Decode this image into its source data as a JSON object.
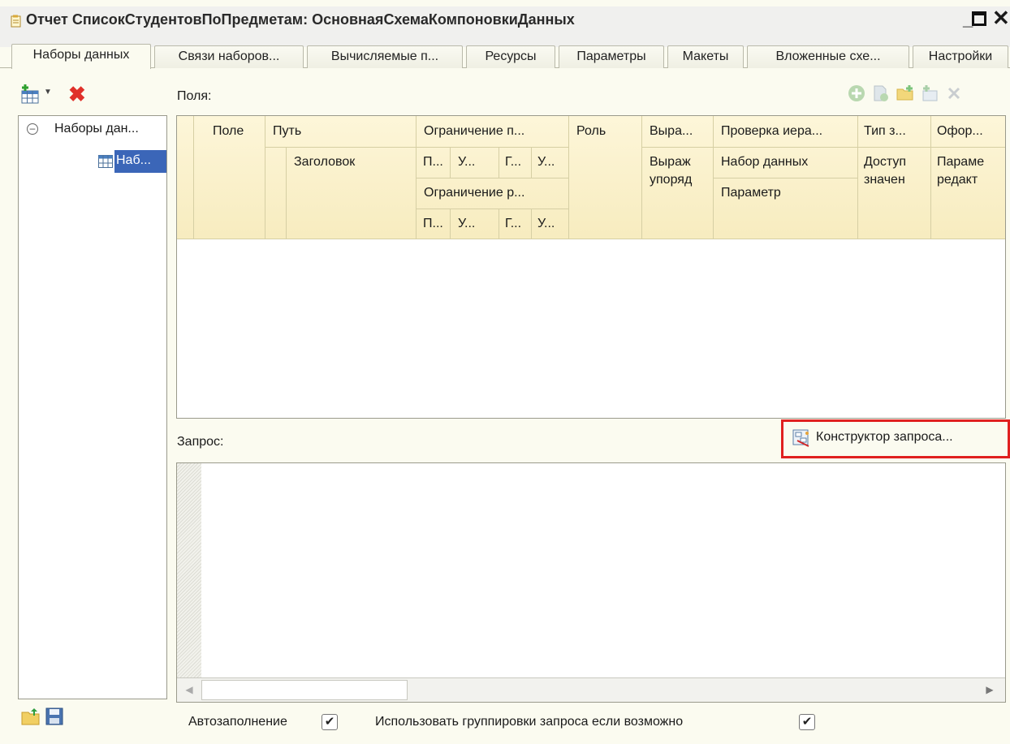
{
  "window": {
    "title": "Отчет СписокСтудентовПоПредметам: ОсновнаяСхемаКомпоновкиДанных",
    "icon": "report-icon"
  },
  "tabs": [
    {
      "label": "Наборы данных",
      "active": true
    },
    {
      "label": "Связи наборов...",
      "active": false
    },
    {
      "label": "Вычисляемые п...",
      "active": false
    },
    {
      "label": "Ресурсы",
      "active": false
    },
    {
      "label": "Параметры",
      "active": false
    },
    {
      "label": "Макеты",
      "active": false
    },
    {
      "label": "Вложенные схе...",
      "active": false
    },
    {
      "label": "Настройки",
      "active": false
    }
  ],
  "tree": {
    "root": "Наборы дан...",
    "child": "Наб..."
  },
  "fields": {
    "label": "Поля:",
    "headers": {
      "field": "Поле",
      "path": "Путь",
      "title": "Заголовок",
      "restriction_top": "Ограничение п...",
      "restriction_top_sub": [
        "П...",
        "У...",
        "Г...",
        "У..."
      ],
      "restriction_bottom": "Ограничение р...",
      "restriction_bottom_sub": [
        "П...",
        "У...",
        "Г...",
        "У..."
      ],
      "role": "Роль",
      "expr": "Выра...",
      "expr_order_1": "Выраж",
      "expr_order_2": "упоряд",
      "hierarchy": "Проверка иера...",
      "dataset": "Набор данных",
      "parameter": "Параметр",
      "type": "Тип з...",
      "avail_1": "Доступ",
      "avail_2": "значен",
      "format": "Офор...",
      "params_1": "Параме",
      "params_2": "редакт"
    },
    "rows": []
  },
  "query": {
    "label": "Запрос:",
    "constructor_label": "Конструктор запроса...",
    "text": ""
  },
  "options": {
    "autofill_label": "Автозаполнение",
    "autofill_checked": true,
    "use_grouping_label": "Использовать группировки запроса если возможно",
    "use_grouping_checked": true
  },
  "colors": {
    "header_bg": "#f7ecbf",
    "selection": "#3b66b8",
    "highlight_border": "#e02020",
    "background": "#fbfbf0"
  }
}
